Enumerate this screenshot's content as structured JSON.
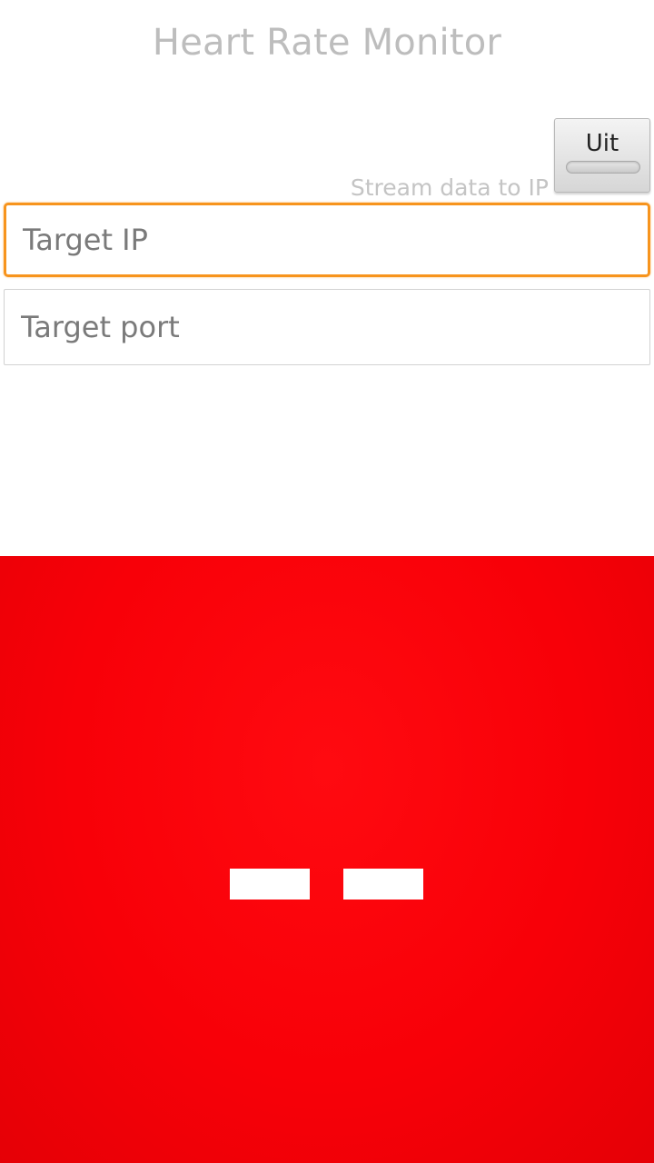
{
  "app": {
    "title": "Heart Rate Monitor"
  },
  "stream": {
    "label": "Stream data to IP",
    "toggle_label": "Uit",
    "enabled": false
  },
  "form": {
    "target_ip": {
      "value": "",
      "placeholder": "Target IP"
    },
    "target_port": {
      "value": "",
      "placeholder": "Target port"
    }
  },
  "camera_preview": {
    "bpm_display": "--",
    "background_color": "#f80008"
  },
  "colors": {
    "focus_accent": "#f7941d",
    "title_gray": "#bdbdbd"
  }
}
